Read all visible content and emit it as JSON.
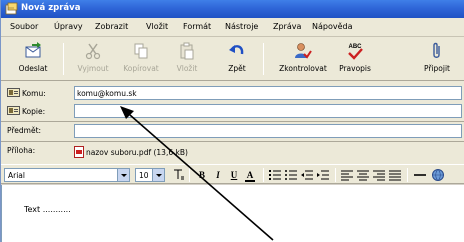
{
  "window": {
    "title": "Nová zpráva"
  },
  "menu": [
    "Soubor",
    "Úpravy",
    "Zobrazit",
    "Vložit",
    "Formát",
    "Nástroje",
    "Zpráva",
    "Nápověda"
  ],
  "toolbar": {
    "send": "Odeslat",
    "cut": "Vyjmout",
    "copy": "Kopírovat",
    "paste": "Vložit",
    "undo": "Zpět",
    "check": "Zkontrolovat",
    "spelling": "Pravopis",
    "attach": "Připojit",
    "spelling_icon_text": "ABC"
  },
  "header": {
    "to_label": "Komu:",
    "to_value": "komu@komu.sk",
    "cc_label": "Kopie:",
    "cc_value": "",
    "subject_label": "Předmět:",
    "subject_value": "",
    "attach_label": "Příloha:",
    "attach_value": "nazov suboru.pdf (13,6 kB)"
  },
  "format": {
    "font": "Arial",
    "size": "10"
  },
  "message": {
    "text": "Text ..........."
  },
  "colors": {
    "titlebar": "#2f66d8",
    "chrome": "#ece9d8",
    "arrow": "#000000"
  }
}
